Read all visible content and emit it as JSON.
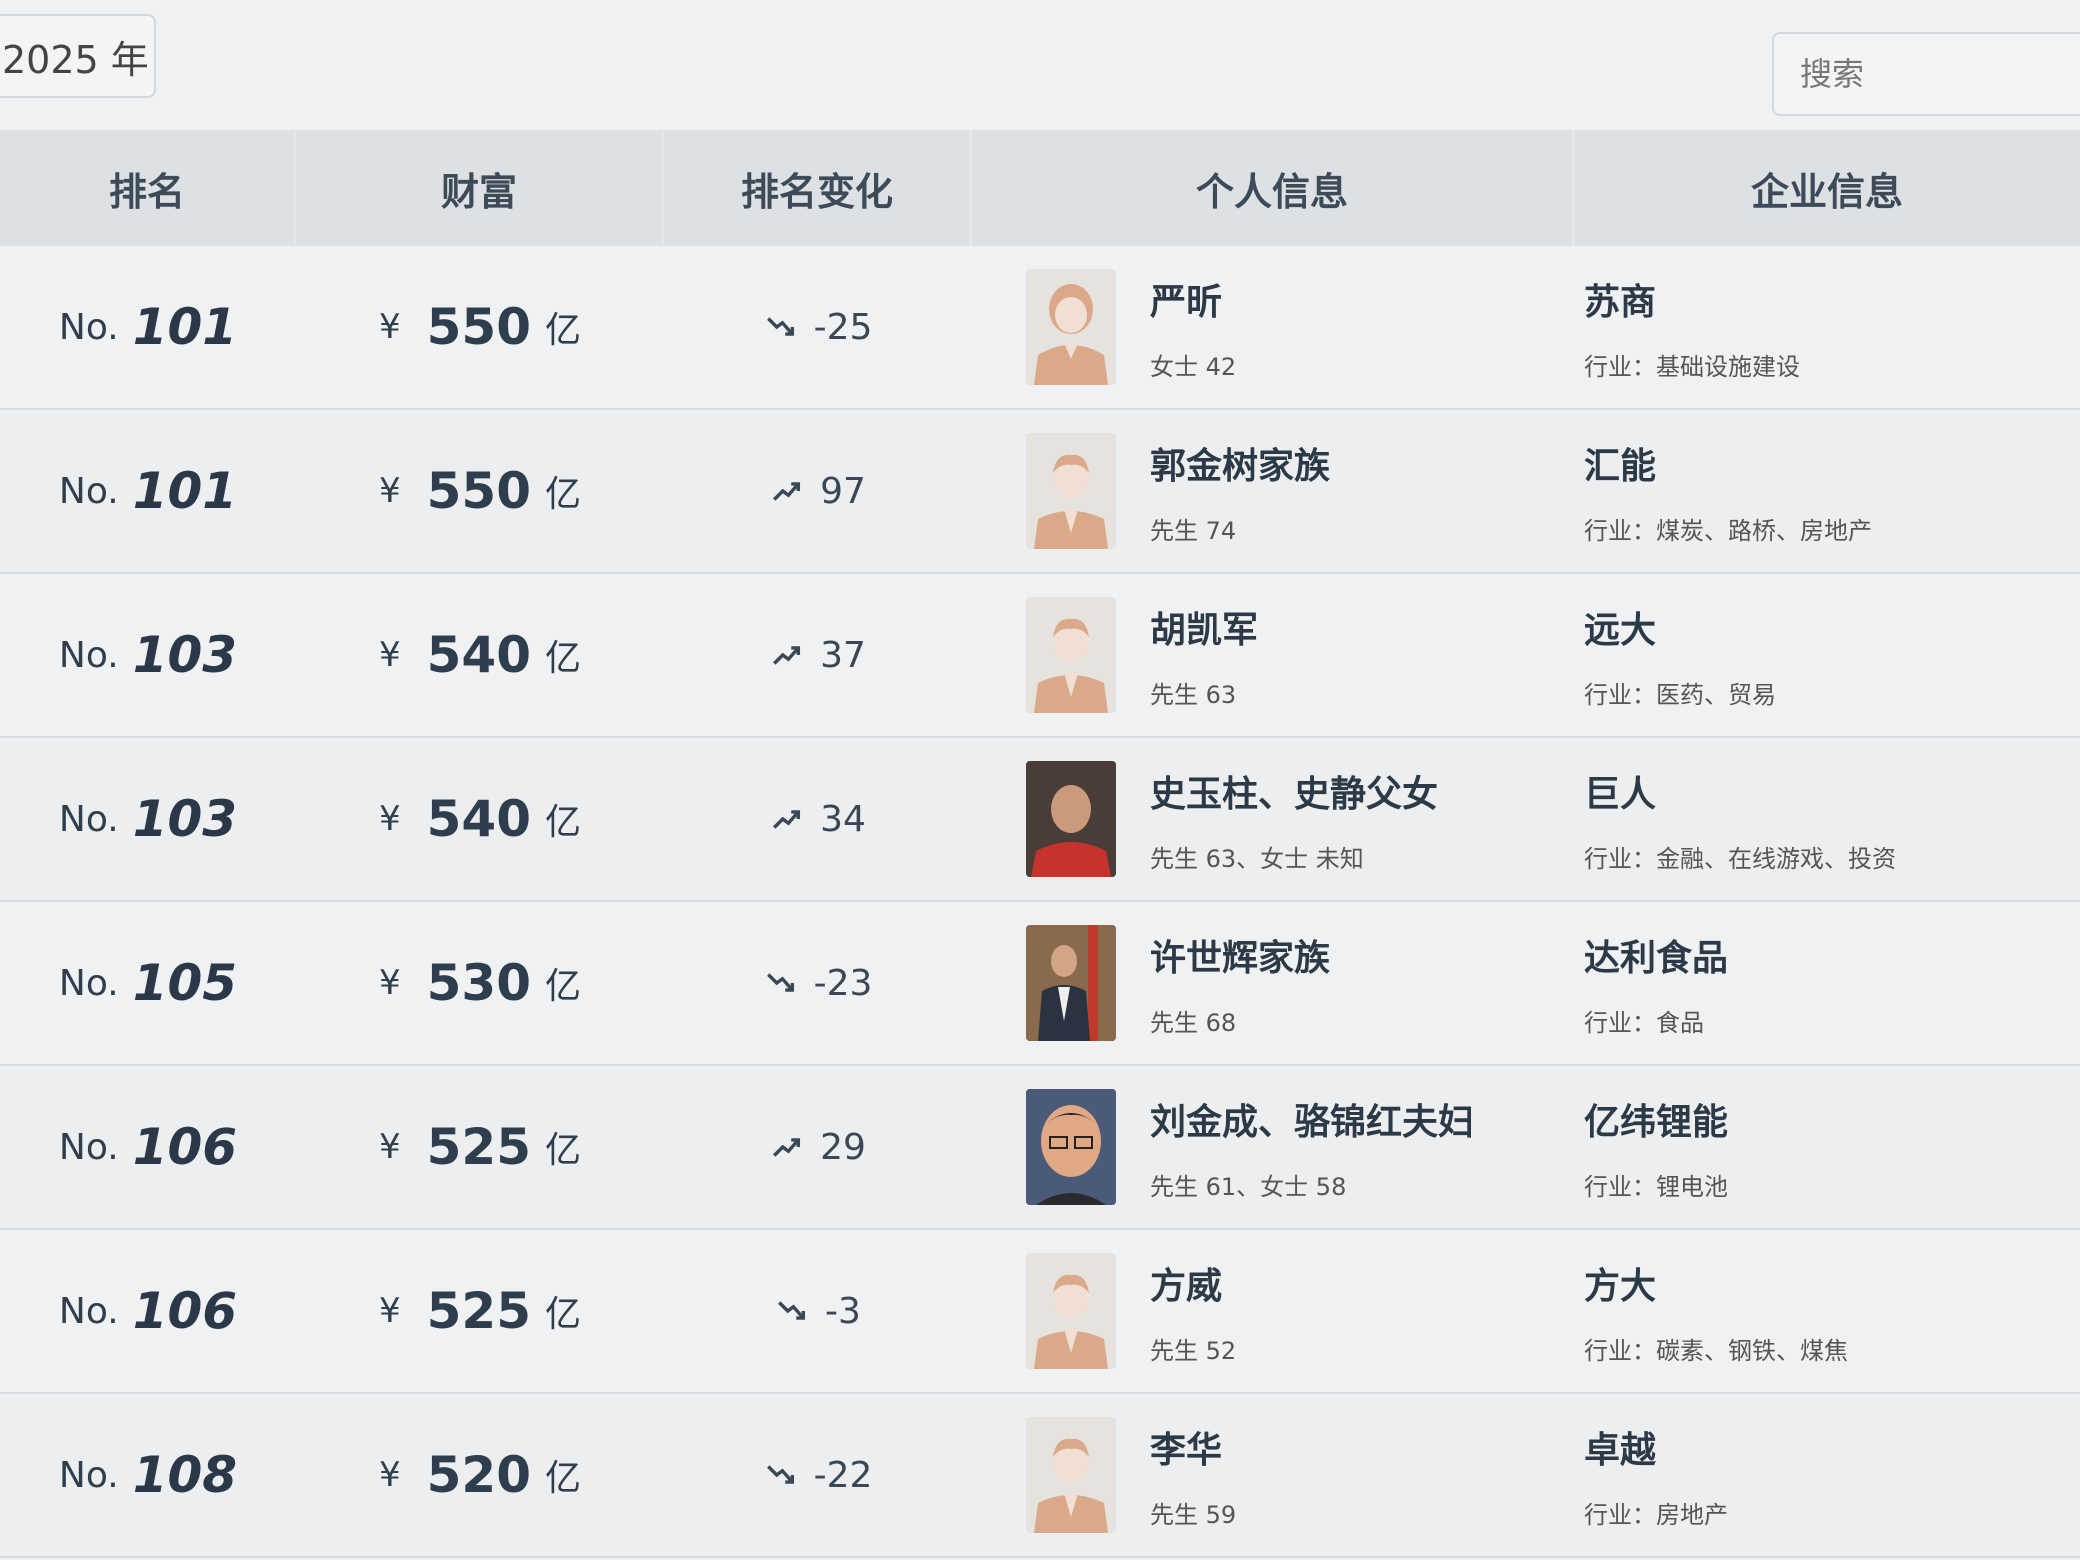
{
  "filters": {
    "year_label": "2025 年",
    "search_placeholder": "搜索"
  },
  "table": {
    "headers": {
      "rank": "排名",
      "wealth": "财富",
      "rank_change": "排名变化",
      "person": "个人信息",
      "company": "企业信息"
    },
    "rows": [
      {
        "rank_prefix": "No.",
        "rank": "101",
        "currency": "¥",
        "wealth": "550",
        "unit": "亿",
        "trend": "down",
        "change": "-25",
        "avatar": "female-placeholder",
        "name": "严昕",
        "meta": "女士 42",
        "company": "苏商",
        "industry": "行业：基础设施建设"
      },
      {
        "rank_prefix": "No.",
        "rank": "101",
        "currency": "¥",
        "wealth": "550",
        "unit": "亿",
        "trend": "up",
        "change": "97",
        "avatar": "male-placeholder",
        "name": "郭金树家族",
        "meta": "先生 74",
        "company": "汇能",
        "industry": "行业：煤炭、路桥、房地产"
      },
      {
        "rank_prefix": "No.",
        "rank": "103",
        "currency": "¥",
        "wealth": "540",
        "unit": "亿",
        "trend": "up",
        "change": "37",
        "avatar": "male-placeholder",
        "name": "胡凯军",
        "meta": "先生 63",
        "company": "远大",
        "industry": "行业：医药、贸易"
      },
      {
        "rank_prefix": "No.",
        "rank": "103",
        "currency": "¥",
        "wealth": "540",
        "unit": "亿",
        "trend": "up",
        "change": "34",
        "avatar": "photo-red",
        "name": "史玉柱、史静父女",
        "meta": "先生 63、女士 未知",
        "company": "巨人",
        "industry": "行业：金融、在线游戏、投资"
      },
      {
        "rank_prefix": "No.",
        "rank": "105",
        "currency": "¥",
        "wealth": "530",
        "unit": "亿",
        "trend": "down",
        "change": "-23",
        "avatar": "photo-suit",
        "name": "许世辉家族",
        "meta": "先生 68",
        "company": "达利食品",
        "industry": "行业：食品"
      },
      {
        "rank_prefix": "No.",
        "rank": "106",
        "currency": "¥",
        "wealth": "525",
        "unit": "亿",
        "trend": "up",
        "change": "29",
        "avatar": "photo-glasses",
        "name": "刘金成、骆锦红夫妇",
        "meta": "先生 61、女士 58",
        "company": "亿纬锂能",
        "industry": "行业：锂电池"
      },
      {
        "rank_prefix": "No.",
        "rank": "106",
        "currency": "¥",
        "wealth": "525",
        "unit": "亿",
        "trend": "down",
        "change": "-3",
        "avatar": "male-placeholder",
        "name": "方威",
        "meta": "先生 52",
        "company": "方大",
        "industry": "行业：碳素、钢铁、煤焦"
      },
      {
        "rank_prefix": "No.",
        "rank": "108",
        "currency": "¥",
        "wealth": "520",
        "unit": "亿",
        "trend": "down",
        "change": "-22",
        "avatar": "male-placeholder",
        "name": "李华",
        "meta": "先生 59",
        "company": "卓越",
        "industry": "行业：房地产"
      }
    ]
  }
}
